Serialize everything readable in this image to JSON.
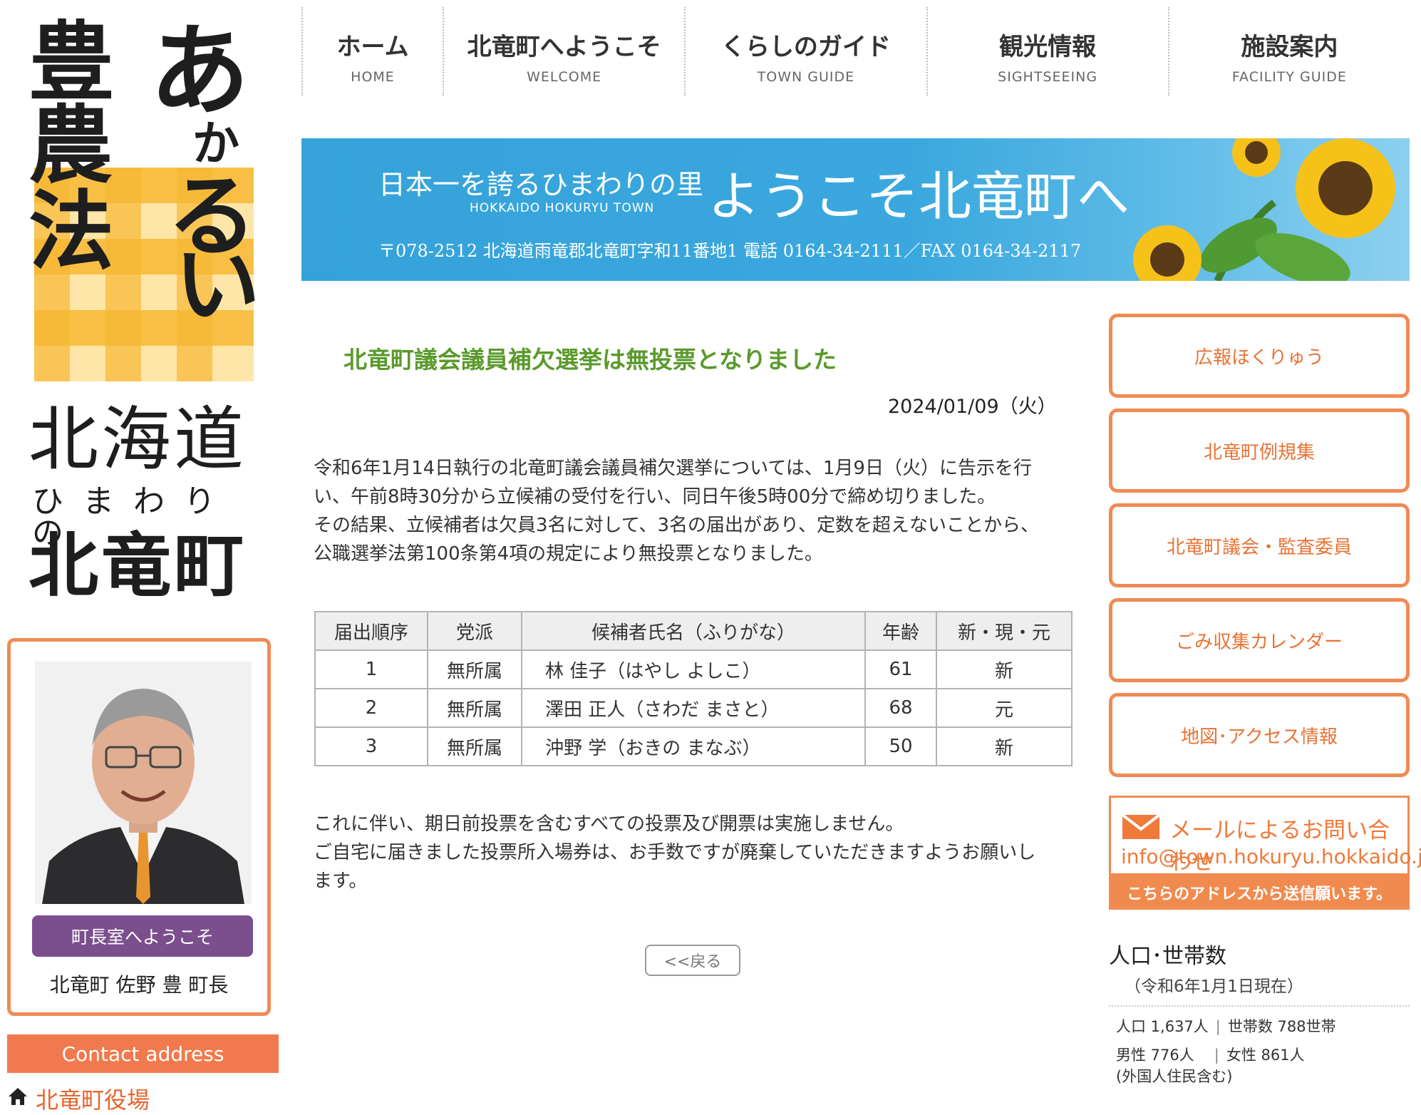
{
  "logo": {
    "left_chars": [
      "豊",
      "農",
      "法"
    ],
    "right_chars": [
      "あ",
      "か",
      "る",
      "い"
    ],
    "hokkaido": "北海道",
    "himawari": "ひまわりの",
    "town": "北竜町"
  },
  "nav": [
    {
      "jp": "ホーム",
      "en": "HOME"
    },
    {
      "jp": "北竜町へようこそ",
      "en": "WELCOME"
    },
    {
      "jp": "くらしのガイド",
      "en": "TOWN GUIDE"
    },
    {
      "jp": "観光情報",
      "en": "SIGHTSEEING"
    },
    {
      "jp": "施設案内",
      "en": "FACILITY GUIDE"
    }
  ],
  "banner": {
    "tagline": "日本一を誇るひまわりの里",
    "tagline_en": "HOKKAIDO HOKURYU TOWN",
    "welcome": "ようこそ北竜町へ",
    "address": "〒078-2512  北海道雨竜郡北竜町字和11番地1   電話 0164-34-2111／FAX 0164-34-2117"
  },
  "mayor": {
    "button": "町長室へようこそ",
    "name": "北竜町 佐野 豊 町長"
  },
  "contact": {
    "bar": "Contact address",
    "office": "北竜町役場"
  },
  "article": {
    "title": "北竜町議会議員補欠選挙は無投票となりました",
    "date": "2024/01/09（火）",
    "para1_line1": "令和6年1月14日執行の北竜町議会議員補欠選挙については、1月9日（火）に告示を行",
    "para1_line2": "い、午前8時30分から立候補の受付を行い、同日午後5時00分で締め切りました。",
    "para1_line3": "その結果、立候補者は欠員3名に対して、3名の届出があり、定数を超えないことから、",
    "para1_line4": "公職選挙法第100条第4項の規定により無投票となりました。",
    "para2_line1": "これに伴い、期日前投票を含むすべての投票及び開票は実施しません。",
    "para2_line2": "ご自宅に届きました投票所入場券は、お手数ですが廃棄していただきますようお願いし",
    "para2_line3": "ます。",
    "back": "<<戻る"
  },
  "table": {
    "headers": [
      "届出順序",
      "党派",
      "候補者氏名（ふりがな）",
      "年齢",
      "新・現・元"
    ],
    "rows": [
      [
        "1",
        "無所属",
        "林 佳子（はやし よしこ）",
        "61",
        "新"
      ],
      [
        "2",
        "無所属",
        "澤田 正人（さわだ まさと）",
        "68",
        "元"
      ],
      [
        "3",
        "無所属",
        "沖野 学（おきの まなぶ）",
        "50",
        "新"
      ]
    ]
  },
  "sidebar": {
    "links": [
      "広報ほくりゅう",
      "北竜町例規集",
      "北竜町議会・監査委員",
      "ごみ収集カレンダー",
      "地図･アクセス情報"
    ],
    "mail_title": "メールによるお問い合わせ",
    "mail_address": "info@town.hokuryu.hokkaido.jp",
    "mail_note": "こちらのアドレスから送信願います。"
  },
  "population": {
    "title": "人口･世帯数",
    "date": "（令和6年1月1日現在）",
    "population": "人口 1,637人",
    "households": "世帯数 788世帯",
    "male": "男性 776人",
    "female": "女性 861人",
    "note": "(外国人住民含む)"
  },
  "colors": {
    "accent_orange": "#f08a55",
    "title_green": "#5a9a2b",
    "mayor_purple": "#7b4e8e",
    "banner_blue": "#3aa8de"
  }
}
